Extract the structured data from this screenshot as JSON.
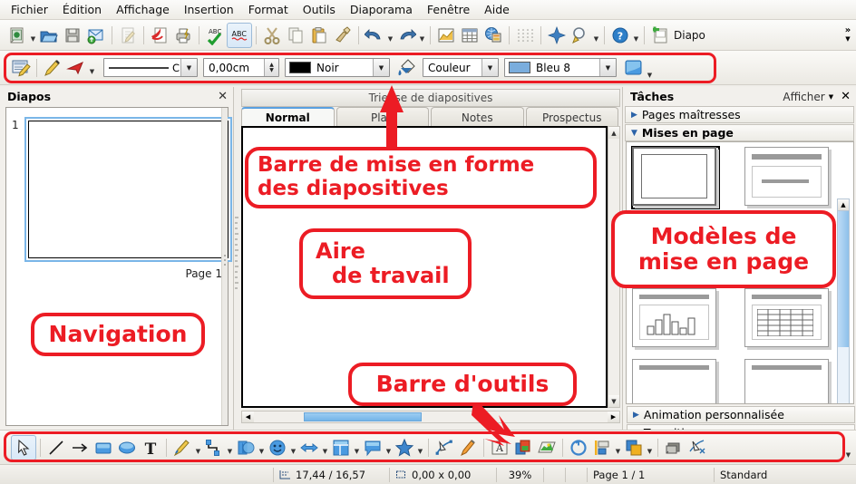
{
  "menubar": {
    "items": [
      {
        "label": "Fichier"
      },
      {
        "label": "Édition"
      },
      {
        "label": "Affichage"
      },
      {
        "label": "Insertion"
      },
      {
        "label": "Format"
      },
      {
        "label": "Outils"
      },
      {
        "label": "Diaporama"
      },
      {
        "label": "Fenêtre"
      },
      {
        "label": "Aide"
      }
    ]
  },
  "toolbar_standard": {
    "overflow_label": "»",
    "buttons": [
      {
        "name": "new-document-icon",
        "tooltip": "Nouveau"
      },
      {
        "name": "open-document-icon",
        "tooltip": "Ouvrir"
      },
      {
        "name": "save-document-icon",
        "tooltip": "Enregistrer"
      },
      {
        "name": "send-email-icon",
        "tooltip": "Envoyer par e-mail"
      },
      {
        "name": "edit-file-icon",
        "tooltip": "Éditer le fichier"
      },
      {
        "name": "export-pdf-icon",
        "tooltip": "Exporter directement en PDF"
      },
      {
        "name": "print-file-icon",
        "tooltip": "Impression rapide"
      },
      {
        "name": "spellcheck-auto-icon",
        "tooltip": "Vérification orthographique"
      },
      {
        "name": "spellcheck-abc-icon",
        "tooltip": "Vérification automatique"
      },
      {
        "name": "cut-icon",
        "tooltip": "Couper"
      },
      {
        "name": "copy-icon",
        "tooltip": "Copier"
      },
      {
        "name": "paste-icon",
        "tooltip": "Coller"
      },
      {
        "name": "clone-formatting-icon",
        "tooltip": "Cloner le formatage"
      },
      {
        "name": "undo-icon",
        "tooltip": "Annuler"
      },
      {
        "name": "redo-icon",
        "tooltip": "Restaurer"
      },
      {
        "name": "insert-chart-icon",
        "tooltip": "Insérer un diagramme"
      },
      {
        "name": "insert-table-icon",
        "tooltip": "Tableau"
      },
      {
        "name": "insert-image-icon",
        "tooltip": "Image"
      },
      {
        "name": "grid-icon",
        "tooltip": "Affichage grille"
      },
      {
        "name": "effects-icon",
        "tooltip": "Effets"
      },
      {
        "name": "zoom-icon",
        "tooltip": "Zoom"
      },
      {
        "name": "help-icon",
        "tooltip": "Aide"
      },
      {
        "name": "new-slide-icon",
        "tooltip": "Diapo"
      }
    ],
    "slide_button_label": "Diapo"
  },
  "toolbar_formatting": {
    "buttons": [
      {
        "name": "slide-properties-icon"
      },
      {
        "name": "pen-icon"
      },
      {
        "name": "arrow-style-icon"
      }
    ],
    "line_style": {
      "value": "C",
      "name": "line-style-combo"
    },
    "line_width": {
      "value": "0,00cm",
      "name": "line-width-spinner"
    },
    "line_color": {
      "value": "Noir",
      "swatch": "#000000",
      "name": "line-color-combo"
    },
    "fill_type": {
      "value": "Couleur",
      "name": "fill-type-combo"
    },
    "fill_color": {
      "value": "Bleu 8",
      "swatch": "#7aaddd",
      "name": "fill-color-combo"
    },
    "shadow": {
      "name": "shadow-toggle-icon"
    }
  },
  "slides_panel": {
    "title": "Diapos",
    "close_label": "✕",
    "slide_number": "1",
    "page_label": "Page 1"
  },
  "center": {
    "view_switch_label": "Trieuse de diapositives",
    "tabs": [
      {
        "label": "Normal",
        "active": true
      },
      {
        "label": "Plan",
        "active": false
      },
      {
        "label": "Notes",
        "active": false
      },
      {
        "label": "Prospectus",
        "active": false
      }
    ]
  },
  "tasks_panel": {
    "title": "Tâches",
    "show_label": "Afficher",
    "close_label": "✕",
    "sections": [
      {
        "label": "Pages maîtresses",
        "expanded": false,
        "bold": false
      },
      {
        "label": "Mises en page",
        "expanded": true,
        "bold": true
      },
      {
        "label": "Animation personnalisée",
        "expanded": false,
        "bold": false
      },
      {
        "label": "Transition",
        "expanded": false,
        "bold": false
      }
    ],
    "layouts": [
      {
        "name": "layout-blank",
        "selected": true
      },
      {
        "name": "layout-title-content",
        "selected": false
      },
      {
        "name": "layout-title-only",
        "selected": false
      },
      {
        "name": "layout-blank-2",
        "selected": false
      },
      {
        "name": "layout-title-chart",
        "selected": false
      },
      {
        "name": "layout-title-table",
        "selected": false
      },
      {
        "name": "layout-row3-left",
        "selected": false
      },
      {
        "name": "layout-row3-right",
        "selected": false
      }
    ]
  },
  "toolbar_drawing": {
    "buttons": [
      {
        "name": "select-arrow-icon",
        "selected": true
      },
      {
        "name": "line-icon"
      },
      {
        "name": "arrow-line-icon"
      },
      {
        "name": "rectangle-icon"
      },
      {
        "name": "ellipse-icon"
      },
      {
        "name": "text-box-icon"
      },
      {
        "name": "curve-icon"
      },
      {
        "name": "connector-icon"
      },
      {
        "name": "basic-shapes-icon"
      },
      {
        "name": "symbol-shapes-icon"
      },
      {
        "name": "block-arrows-icon"
      },
      {
        "name": "flowchart-icon"
      },
      {
        "name": "callouts-icon"
      },
      {
        "name": "stars-icon"
      },
      {
        "name": "points-edit-icon"
      },
      {
        "name": "glue-points-icon"
      },
      {
        "name": "fontwork-icon"
      },
      {
        "name": "from-file-image-icon"
      },
      {
        "name": "gallery-icon"
      },
      {
        "name": "rotate-icon"
      },
      {
        "name": "align-icon"
      },
      {
        "name": "arrange-icon"
      },
      {
        "name": "shadow-icon"
      },
      {
        "name": "crop-icon"
      }
    ]
  },
  "statusbar": {
    "cursor_position": "17,44 / 16,57",
    "selection_size": "0,00 x 0,00",
    "zoom": "39%",
    "page_info": "Page 1 / 1",
    "master_name": "Standard"
  },
  "callouts": [
    {
      "name": "callout-formatting-bar",
      "lines": [
        "Barre de mise en forme",
        "des diapositives"
      ]
    },
    {
      "name": "callout-work-area",
      "lines": [
        "Aire",
        "de travail"
      ]
    },
    {
      "name": "callout-navigation",
      "lines": [
        "Navigation"
      ]
    },
    {
      "name": "callout-layout-models",
      "lines": [
        "Modèles de",
        "mise en page"
      ]
    },
    {
      "name": "callout-toolbar",
      "lines": [
        "Barre d'outils"
      ]
    }
  ],
  "colors": {
    "annotation_red": "#ec1c24",
    "accent_blue": "#7ab6e8",
    "fill_blue": "#7aaddd"
  }
}
